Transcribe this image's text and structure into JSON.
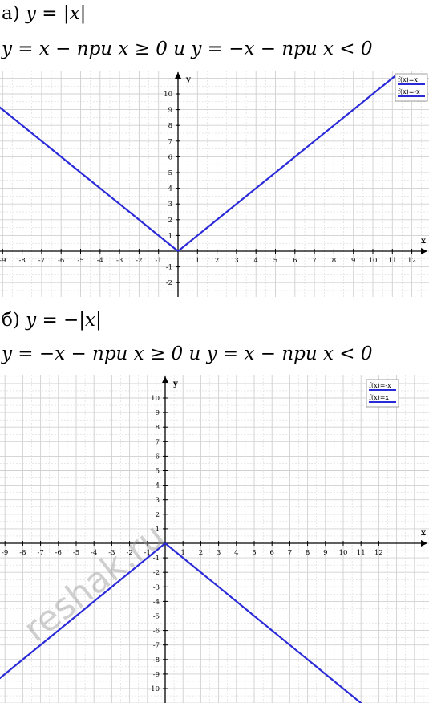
{
  "part_a": {
    "header": {
      "letter": "а)",
      "formula": "y = |x|"
    },
    "definition": "y = x − при x ≥ 0   и   y = −x − при x < 0"
  },
  "part_b": {
    "header": {
      "letter": "б)",
      "formula": "y = −|x|"
    },
    "definition": "y = −x − при x ≥ 0  и   y = x − при x < 0"
  },
  "watermark": "reshak.ru",
  "colors": {
    "line": "#2a2ad8",
    "grid": "#d0d0d0",
    "axis": "#000000"
  },
  "chart_data": [
    {
      "type": "line",
      "xlabel": "x",
      "ylabel": "y",
      "xlim": [
        -9,
        12
      ],
      "ylim": [
        -2,
        10
      ],
      "x_ticks": [
        -9,
        -8,
        -7,
        -6,
        -5,
        -4,
        -3,
        -2,
        -1,
        1,
        2,
        3,
        4,
        5,
        6,
        7,
        8,
        9,
        10,
        11,
        12
      ],
      "y_ticks": [
        -2,
        -1,
        1,
        2,
        3,
        4,
        5,
        6,
        7,
        8,
        9,
        10
      ],
      "grid": true,
      "legend_position": "top-right",
      "series": [
        {
          "name": "f(x)=x",
          "x": [
            0,
            11.2
          ],
          "y": [
            0,
            11.2
          ]
        },
        {
          "name": "f(x)=-x",
          "x": [
            -9.4,
            0
          ],
          "y": [
            9.4,
            0
          ]
        }
      ]
    },
    {
      "type": "line",
      "xlabel": "x",
      "ylabel": "y",
      "xlim": [
        -9,
        12
      ],
      "ylim": [
        -11,
        10
      ],
      "x_ticks": [
        -9,
        -8,
        -7,
        -6,
        -5,
        -4,
        -3,
        -2,
        -1,
        1,
        2,
        3,
        4,
        5,
        6,
        7,
        8,
        9,
        10,
        11,
        12
      ],
      "y_ticks": [
        -10,
        -9,
        -8,
        -7,
        -6,
        -5,
        -4,
        -3,
        -2,
        -1,
        1,
        2,
        3,
        4,
        5,
        6,
        7,
        8,
        9,
        10
      ],
      "grid": true,
      "legend_position": "top-right",
      "series": [
        {
          "name": "f(x)=-x",
          "x": [
            0,
            11.2
          ],
          "y": [
            0,
            -11.2
          ]
        },
        {
          "name": "f(x)=x",
          "x": [
            -9.4,
            0
          ],
          "y": [
            -9.4,
            0
          ]
        }
      ]
    }
  ]
}
